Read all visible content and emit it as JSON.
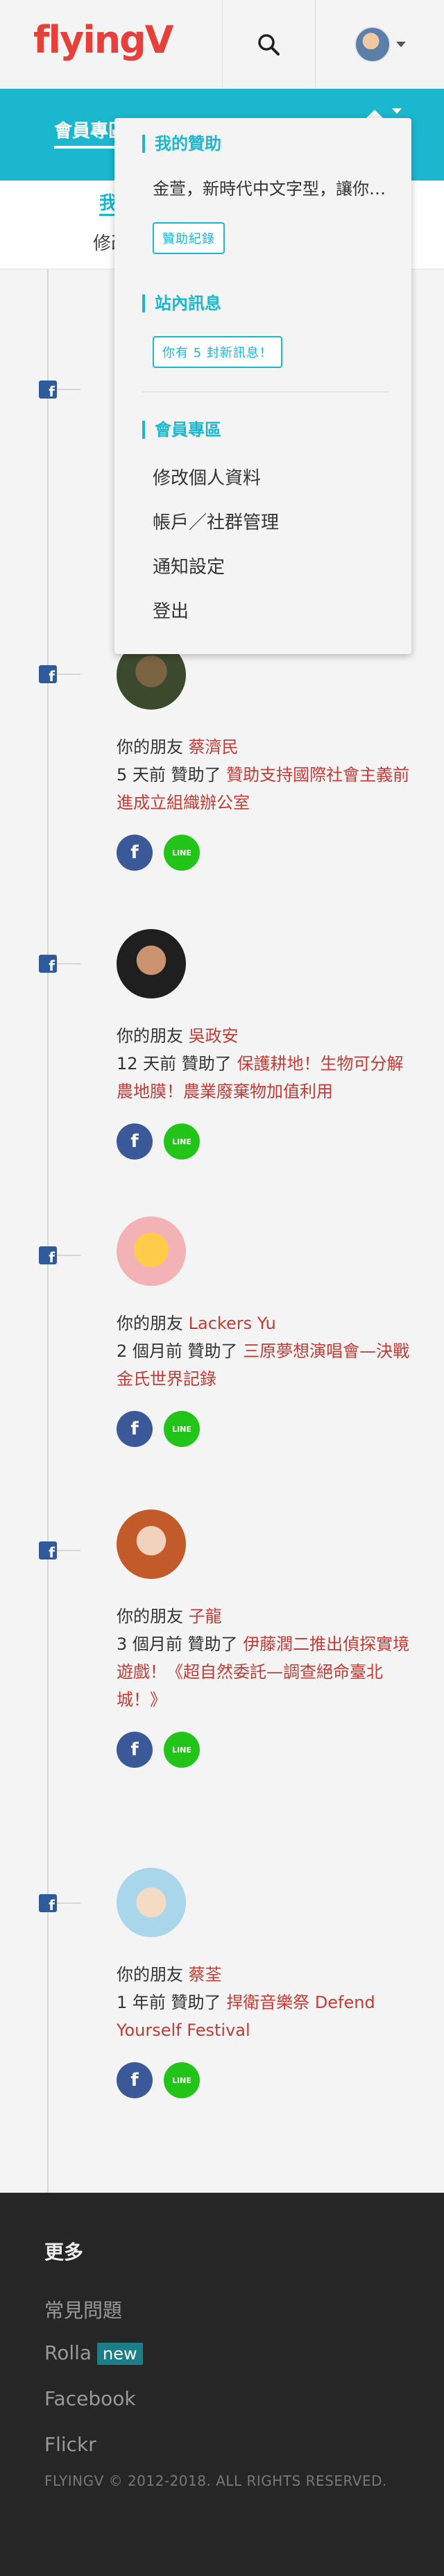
{
  "header": {
    "logo": "flyingV",
    "colors": {
      "brand": "#e5403a",
      "accent": "#1ab7ce"
    }
  },
  "tabbar": {
    "label": "會員專區"
  },
  "subtabs": {
    "first": "我",
    "second": "修改"
  },
  "dropdown": {
    "sponsor": {
      "title": "我的贊助",
      "latest": "金萱，新時代中文字型，讓你的作品更好看",
      "button": "贊助紀錄"
    },
    "inbox": {
      "title": "站內訊息",
      "button": "你有 5 封新訊息！"
    },
    "member": {
      "title": "會員專區",
      "items": [
        "修改個人資料",
        "帳戶／社群管理",
        "通知設定",
        "登出"
      ]
    }
  },
  "feed": [
    {
      "prefix": "你的朋友",
      "friend": "蔡濟民",
      "time": "5 天前",
      "verb": "贊助了",
      "project": "贊助支持國際社會主義前進成立組織辦公室",
      "fb": "f",
      "line": "LINE"
    },
    {
      "prefix": "你的朋友",
      "friend": "吳政安",
      "time": "12 天前",
      "verb": "贊助了",
      "project": "保護耕地！生物可分解農地膜！農業廢棄物加值利用",
      "fb": "f",
      "line": "LINE"
    },
    {
      "prefix": "你的朋友",
      "friend": "Lackers Yu",
      "time": "2 個月前",
      "verb": "贊助了",
      "project": "三原夢想演唱會—決戰金氏世界記錄",
      "fb": "f",
      "line": "LINE"
    },
    {
      "prefix": "你的朋友",
      "friend": "子龍",
      "time": "3 個月前",
      "verb": "贊助了",
      "project": "伊藤潤二推出偵探實境遊戲！《超自然委託—調查絕命臺北城！》",
      "fb": "f",
      "line": "LINE"
    },
    {
      "prefix": "你的朋友",
      "friend": "蔡荃",
      "time": "1 年前",
      "verb": "贊助了",
      "project": "捍衛音樂祭 Defend Yourself Festival",
      "fb": "f",
      "line": "LINE"
    }
  ],
  "footer": {
    "title": "更多",
    "links": [
      "常見問題",
      "Rolla",
      "Facebook",
      "Flickr"
    ],
    "new_badge": "new",
    "copyright": "FLYINGV © 2012-2018. ALL RIGHTS RESERVED."
  }
}
